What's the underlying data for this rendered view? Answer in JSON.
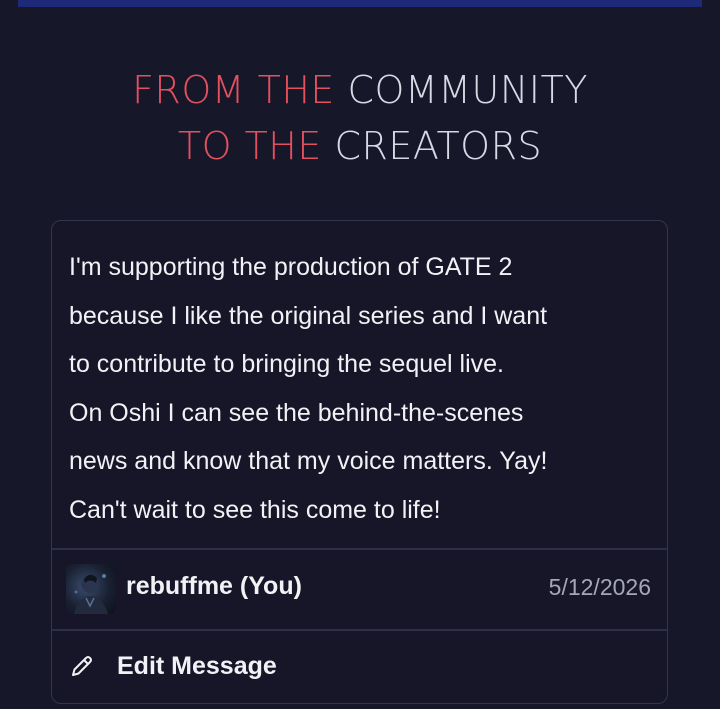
{
  "heading": {
    "line1_accent": "FROM THE",
    "line1_plain": "COMMUNITY",
    "line2_accent": "TO THE",
    "line2_plain": "CREATORS"
  },
  "card": {
    "message_lines": [
      "I'm supporting the production of GATE 2",
      "because I like the original series and I want",
      "to contribute to bringing the sequel live.",
      "On Oshi I can see the behind-the-scenes",
      "news and know that my voice matters. Yay!",
      "Can't wait to see this come to life!"
    ],
    "author": {
      "name": "rebuffme (You)",
      "date": "5/12/2026",
      "avatar_icon": "user-avatar"
    },
    "edit": {
      "label": "Edit Message",
      "icon": "pencil-icon"
    }
  },
  "colors": {
    "background": "#17172a",
    "accent": "#e3505e",
    "heading_plain": "#d7d9e4",
    "card_border": "#34354a",
    "top_bar": "#1e2a78"
  }
}
